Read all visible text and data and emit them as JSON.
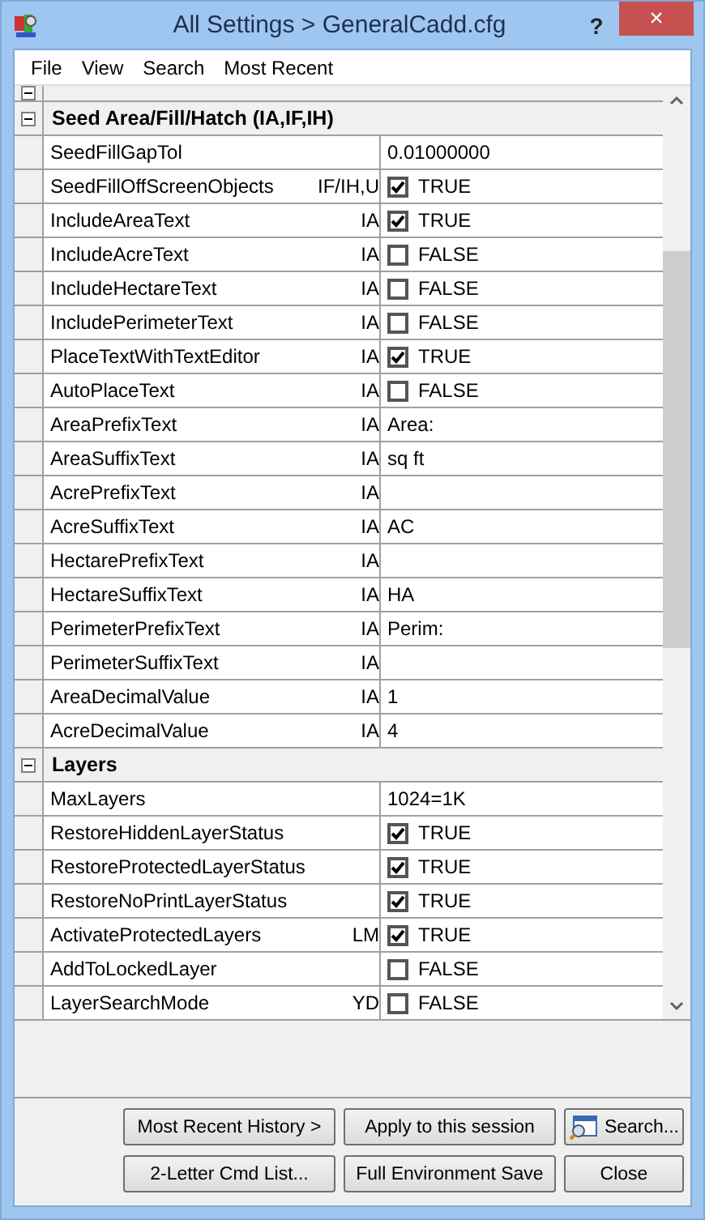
{
  "window": {
    "title": "All Settings > GeneralCadd.cfg",
    "help": "?",
    "close": "×"
  },
  "menu": [
    {
      "label": "File"
    },
    {
      "label": "View"
    },
    {
      "label": "Search"
    },
    {
      "label": "Most Recent"
    }
  ],
  "categories": [
    {
      "expanded": true
    },
    {
      "title": "Seed Area/Fill/Hatch (IA,IF,IH)",
      "expanded": true,
      "items": [
        {
          "name": "SeedFillGapTol",
          "kind": "text",
          "value": "0.01000000"
        },
        {
          "name": "SeedFillOffScreenObjects",
          "code": "IF/IH,U",
          "kind": "checkbox",
          "checked": true,
          "value": "TRUE"
        },
        {
          "name": "IncludeAreaText",
          "code": "IA",
          "kind": "checkbox",
          "checked": true,
          "value": "TRUE"
        },
        {
          "name": "IncludeAcreText",
          "code": "IA",
          "kind": "checkbox",
          "checked": false,
          "value": "FALSE"
        },
        {
          "name": "IncludeHectareText",
          "code": "IA",
          "kind": "checkbox",
          "checked": false,
          "value": "FALSE"
        },
        {
          "name": "IncludePerimeterText",
          "code": "IA",
          "kind": "checkbox",
          "checked": false,
          "value": "FALSE"
        },
        {
          "name": "PlaceTextWithTextEditor",
          "code": "IA",
          "kind": "checkbox",
          "checked": true,
          "value": "TRUE"
        },
        {
          "name": "AutoPlaceText",
          "code": "IA",
          "kind": "checkbox",
          "checked": false,
          "value": "FALSE"
        },
        {
          "name": "AreaPrefixText",
          "code": "IA",
          "kind": "text",
          "value": "Area:"
        },
        {
          "name": "AreaSuffixText",
          "code": "IA",
          "kind": "text",
          "value": "sq ft"
        },
        {
          "name": "AcrePrefixText",
          "code": "IA",
          "kind": "text"
        },
        {
          "name": "AcreSuffixText",
          "code": "IA",
          "kind": "text",
          "value": "AC"
        },
        {
          "name": "HectarePrefixText",
          "code": "IA",
          "kind": "text"
        },
        {
          "name": "HectareSuffixText",
          "code": "IA",
          "kind": "text",
          "value": "HA"
        },
        {
          "name": "PerimeterPrefixText",
          "code": "IA",
          "kind": "text",
          "value": "Perim:"
        },
        {
          "name": "PerimeterSuffixText",
          "code": "IA",
          "kind": "text"
        },
        {
          "name": "AreaDecimalValue",
          "code": "IA",
          "kind": "text",
          "value": "1"
        },
        {
          "name": "AcreDecimalValue",
          "code": "IA",
          "kind": "text",
          "value": "4"
        }
      ]
    },
    {
      "title": "Layers",
      "expanded": true,
      "items": [
        {
          "name": "MaxLayers",
          "kind": "text",
          "value": "1024=1K"
        },
        {
          "name": "RestoreHiddenLayerStatus",
          "kind": "checkbox",
          "checked": true,
          "value": "TRUE"
        },
        {
          "name": "RestoreProtectedLayerStatus",
          "kind": "checkbox",
          "checked": true,
          "value": "TRUE"
        },
        {
          "name": "RestoreNoPrintLayerStatus",
          "kind": "checkbox",
          "checked": true,
          "value": "TRUE"
        },
        {
          "name": "ActivateProtectedLayers",
          "code": "LM",
          "kind": "checkbox",
          "checked": true,
          "value": "TRUE"
        },
        {
          "name": "AddToLockedLayer",
          "kind": "checkbox",
          "checked": false,
          "value": "FALSE"
        },
        {
          "name": "LayerSearchMode",
          "code": "YD",
          "kind": "checkbox",
          "checked": false,
          "value": "FALSE"
        }
      ]
    }
  ],
  "buttons": [
    {
      "label": "Most Recent History >"
    },
    {
      "label": "Apply to this session"
    },
    {
      "label": "Search...",
      "icon": true
    },
    {
      "label": "2-Letter Cmd List..."
    },
    {
      "label": "Full Environment Save"
    },
    {
      "label": "Close"
    }
  ]
}
